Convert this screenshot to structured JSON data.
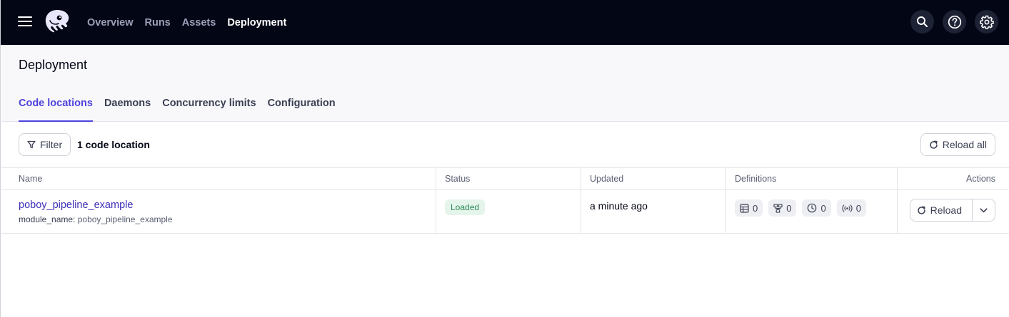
{
  "topbar": {
    "nav": [
      "Overview",
      "Runs",
      "Assets",
      "Deployment"
    ],
    "active_nav": "Deployment",
    "icons": [
      "search-icon",
      "help-icon",
      "gear-icon"
    ]
  },
  "page": {
    "title": "Deployment",
    "tabs": [
      "Code locations",
      "Daemons",
      "Concurrency limits",
      "Configuration"
    ],
    "active_tab": "Code locations"
  },
  "toolbar": {
    "filter_label": "Filter",
    "count_label": "1 code location",
    "reload_all_label": "Reload all"
  },
  "table": {
    "columns": [
      "Name",
      "Status",
      "Updated",
      "Definitions",
      "Actions"
    ],
    "rows": [
      {
        "name": "poboy_pipeline_example",
        "meta_key": "module_name:",
        "meta_value": "poboy_pipeline_example",
        "status": "Loaded",
        "updated": "a minute ago",
        "definitions": {
          "assets": "0",
          "jobs": "0",
          "schedules": "0",
          "sensors": "0"
        },
        "action_label": "Reload"
      }
    ]
  },
  "colors": {
    "topbar_bg": "#030615",
    "accent": "#4f43dd",
    "link": "#3b2fb5",
    "status_loaded_bg": "#e5f5ec",
    "status_loaded_text": "#2f8a55"
  }
}
